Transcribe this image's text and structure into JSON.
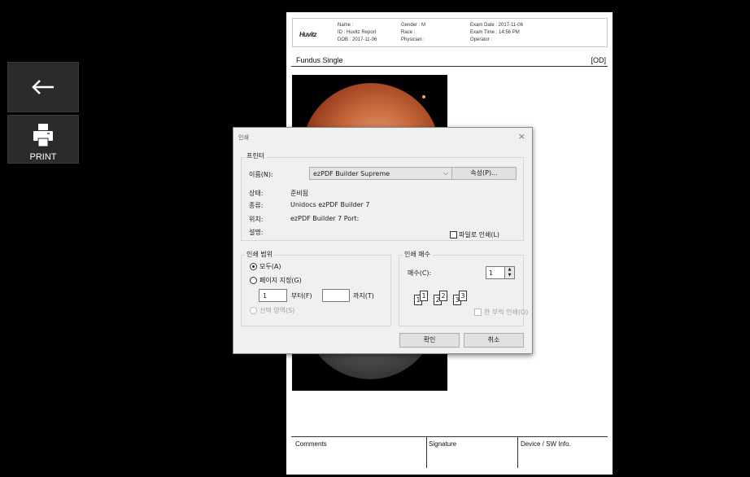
{
  "sidebar": {
    "back_icon": "left-arrow-icon",
    "print_label": "PRINT",
    "print_icon": "printer-icon"
  },
  "report": {
    "logo": "Huvitz",
    "header": {
      "col1": [
        "Name :",
        "ID : Huvitz Report",
        "DOB : 2017-11-06"
      ],
      "col2": [
        "Gender : M",
        "Race :",
        "Physician :"
      ],
      "col3": [
        "Exam Date : 2017-11-06",
        "Exam Time : 14:56 PM",
        "Operator :"
      ]
    },
    "section_title": "Fundus Single",
    "eye": "[OD]",
    "footer": {
      "comments": "Comments",
      "signature": "Signature",
      "device": "Device / SW Info."
    }
  },
  "dialog": {
    "title": "인쇄",
    "close": "×",
    "printer_group": "프린터",
    "name_label": "이름(N):",
    "printer_name": "ezPDF Builder Supreme",
    "properties_button": "속성(P)...",
    "status_label": "상태:",
    "status_value": "준비됨",
    "type_label": "종류:",
    "type_value": "Unidocs ezPDF Builder 7",
    "location_label": "위치:",
    "location_value": "ezPDF Builder 7 Port:",
    "comment_label": "설명:",
    "print_to_file": "파일로 인쇄(L)",
    "range_group": "인쇄 범위",
    "range_all": "모두(A)",
    "range_pages": "페이지 지정(G)",
    "from_value": "1",
    "from_label": "부터(F)",
    "to_value": "",
    "to_label": "까지(T)",
    "range_selection": "선택 영역(S)",
    "copies_group": "인쇄 매수",
    "copies_label": "매수(C):",
    "copies_value": "1",
    "collate_label": "한 부씩 인쇄(O)",
    "collate_pages": [
      "1",
      "1",
      "2",
      "2",
      "3",
      "3"
    ],
    "ok_button": "확인",
    "cancel_button": "취소"
  }
}
